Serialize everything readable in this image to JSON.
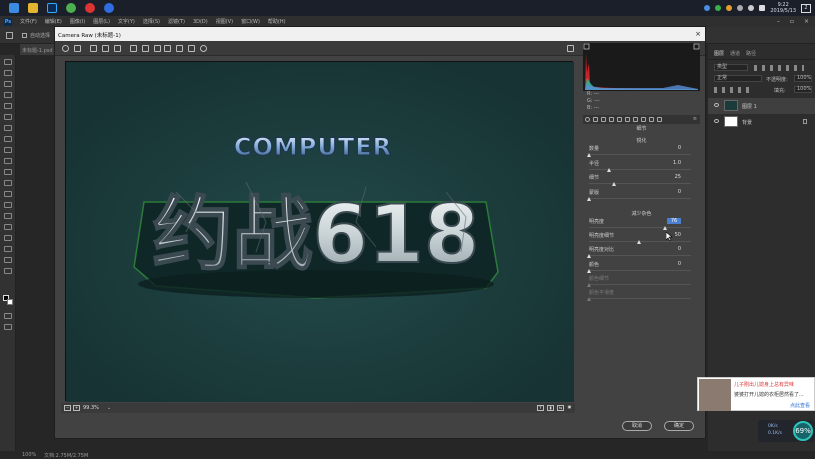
{
  "taskbar": {
    "clock_time": "9:22",
    "clock_date": "2019/5/13",
    "notification_count": "2"
  },
  "photoshop": {
    "menu": [
      "文件(F)",
      "编辑(E)",
      "图像(I)",
      "图层(L)",
      "文字(Y)",
      "选择(S)",
      "滤镜(T)",
      "3D(D)",
      "视图(V)",
      "窗口(W)",
      "帮助(H)"
    ],
    "options_label": "自动选择",
    "doc_tab": "未标题-1.psd",
    "status_zoom": "100%",
    "status_doc": "文档:2.75M/2.75M",
    "layers_panel": {
      "tabs": [
        "图层",
        "通道",
        "路径"
      ],
      "kind_filter": "类型",
      "blend_mode": "正常",
      "opacity_label": "不透明度:",
      "opacity_value": "100%",
      "fill_label": "填充:",
      "fill_value": "100%",
      "layers": [
        {
          "name": "图层 1",
          "selected": true
        },
        {
          "name": "背景",
          "selected": false
        }
      ]
    }
  },
  "camera_raw": {
    "title": "Camera Raw (未标题-1)",
    "zoom": "99.3%",
    "artwork": {
      "top_word": "COMPUTER",
      "main_word": "约战618"
    },
    "rgb_readout": [
      "R: ---",
      "G: ---",
      "B: ---"
    ],
    "panel_title": "细节",
    "sharpen": {
      "title": "锐化",
      "sliders": [
        {
          "label": "数量",
          "value": "0",
          "fraction": 0.0
        },
        {
          "label": "半径",
          "value": "1.0",
          "fraction": 0.2
        },
        {
          "label": "细节",
          "value": "25",
          "fraction": 0.25
        },
        {
          "label": "蒙版",
          "value": "0",
          "fraction": 0.0
        }
      ]
    },
    "noise": {
      "title": "减少杂色",
      "sliders": [
        {
          "label": "明亮度",
          "value": "76",
          "fraction": 0.76,
          "highlight": true,
          "disabled": false
        },
        {
          "label": "明亮度细节",
          "value": "50",
          "fraction": 0.5,
          "highlight": false,
          "disabled": false
        },
        {
          "label": "明亮度对比",
          "value": "0",
          "fraction": 0.0,
          "highlight": false,
          "disabled": false
        },
        {
          "label": "颜色",
          "value": "0",
          "fraction": 0.0,
          "highlight": false,
          "disabled": false
        },
        {
          "label": "颜色细节",
          "value": "",
          "fraction": 0.0,
          "highlight": false,
          "disabled": true
        },
        {
          "label": "颜色平滑度",
          "value": "",
          "fraction": 0.0,
          "highlight": false,
          "disabled": true
        }
      ]
    },
    "buttons": {
      "cancel": "取消",
      "ok": "确定"
    }
  },
  "notification": {
    "headline": "儿子刚出儿媳身上总有异味",
    "body": "婆婆打开儿媳的衣柜居然看了...",
    "link": "点此查看"
  },
  "net_widget": {
    "up": "0K/s",
    "down": "0.1K/s",
    "percent": "69%"
  },
  "colors": {
    "preview_bg": "#1b3b3b",
    "accent_highlight": "#4a7fd0",
    "ring": "#2ec3b8"
  }
}
